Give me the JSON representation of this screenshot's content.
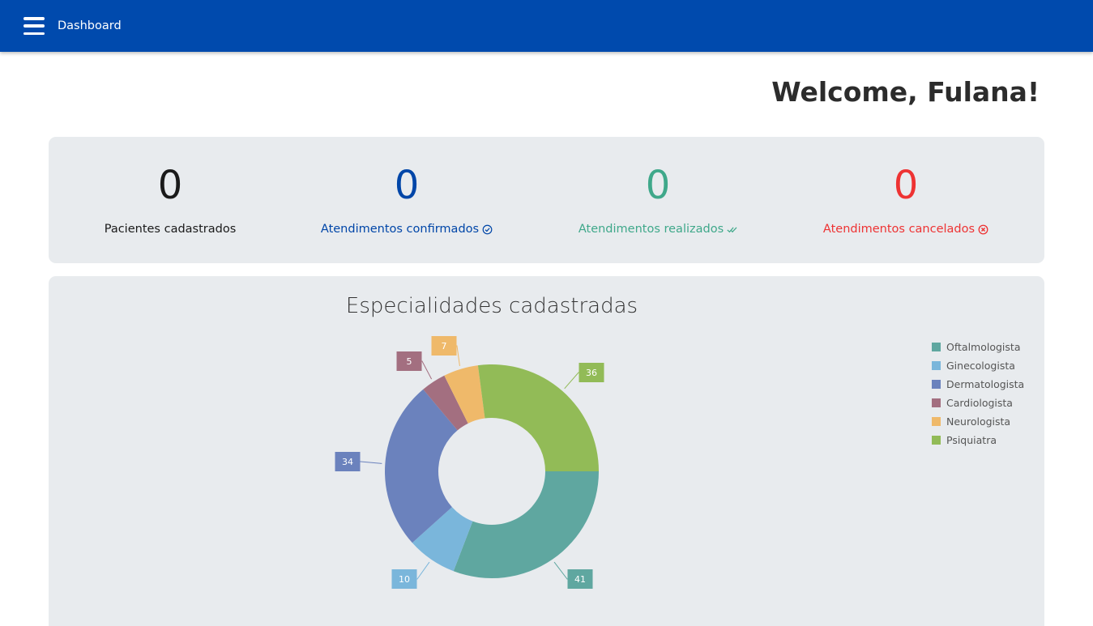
{
  "header": {
    "title": "Dashboard",
    "background": "#004aad",
    "menu_icon": "hamburger-menu-icon"
  },
  "welcome": "Welcome, Fulana!",
  "stats": [
    {
      "value": "0",
      "label": "Pacientes cadastrados",
      "color": "#1a1a1a",
      "icon": ""
    },
    {
      "value": "0",
      "label": "Atendimentos confirmados",
      "color": "#0046a8",
      "icon": "check-circle-icon"
    },
    {
      "value": "0",
      "label": "Atendimentos realizados",
      "color": "#3fa88a",
      "icon": "double-check-icon"
    },
    {
      "value": "0",
      "label": "Atendimentos cancelados",
      "color": "#ee3333",
      "icon": "x-circle-icon"
    }
  ],
  "chart_data": {
    "type": "pie",
    "title": "Especialidades cadastradas",
    "donut": true,
    "legend_position": "top-right",
    "categories": [
      "Oftalmologista",
      "Ginecologista",
      "Dermatologista",
      "Cardiologista",
      "Neurologista",
      "Psiquiatra"
    ],
    "values": [
      41,
      10,
      34,
      5,
      7,
      36
    ],
    "colors": [
      "#5fa7a0",
      "#7ab6db",
      "#6b82bd",
      "#a36f80",
      "#efb96a",
      "#92bb57"
    ]
  }
}
